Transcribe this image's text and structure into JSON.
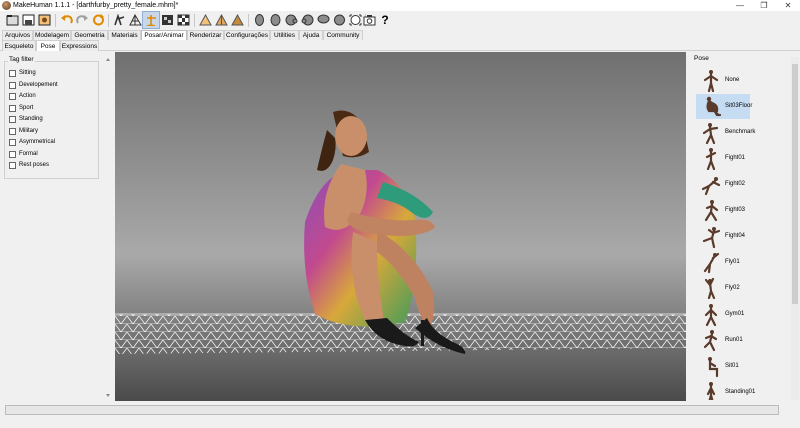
{
  "window": {
    "title": "MakeHuman 1.1.1 - [darthfurby_pretty_female.mhm]*",
    "minimize_glyph": "—",
    "maximize_glyph": "❐",
    "close_glyph": "✕"
  },
  "toolbar": {
    "buttons": [
      {
        "icon": "undo-icon"
      },
      {
        "icon": "redo-icon"
      },
      {
        "icon": "reset-icon"
      },
      {
        "icon": "skeleton-toggle-icon"
      },
      {
        "icon": "wireframe-toggle-icon"
      },
      {
        "icon": "pose-toggle-icon"
      },
      {
        "icon": "background-toggle-icon"
      },
      {
        "icon": "checker-toggle-icon"
      },
      {
        "icon": "front-view-icon"
      },
      {
        "icon": "side-view-icon"
      },
      {
        "icon": "back-view-icon"
      },
      {
        "icon": "head-view-1-icon"
      },
      {
        "icon": "head-view-2-icon"
      },
      {
        "icon": "head-view-3-icon"
      },
      {
        "icon": "head-view-4-icon"
      },
      {
        "icon": "head-view-5-icon"
      },
      {
        "icon": "reset-camera-icon"
      },
      {
        "icon": "screenshot-icon"
      }
    ],
    "help_label": "?"
  },
  "tabs": [
    {
      "label": "Arquivos"
    },
    {
      "label": "Modelagem"
    },
    {
      "label": "Geometria"
    },
    {
      "label": "Materiais"
    },
    {
      "label": "Posar/Animar"
    },
    {
      "label": "Renderizar"
    },
    {
      "label": "Configurações"
    },
    {
      "label": "Utilities"
    },
    {
      "label": "Ajuda"
    },
    {
      "label": "Community"
    }
  ],
  "active_tab": "Posar/Animar",
  "subtabs": [
    {
      "label": "Esqueleto"
    },
    {
      "label": "Pose"
    },
    {
      "label": "Expressions"
    }
  ],
  "active_subtab": "Pose",
  "tag_filter": {
    "title": "Tag filter",
    "items": [
      {
        "label": "Sitting",
        "checked": false
      },
      {
        "label": "Developement",
        "checked": false
      },
      {
        "label": "Action",
        "checked": false
      },
      {
        "label": "Sport",
        "checked": false
      },
      {
        "label": "Standing",
        "checked": false
      },
      {
        "label": "Military",
        "checked": false
      },
      {
        "label": "Asymmetrical",
        "checked": false
      },
      {
        "label": "Formal",
        "checked": false
      },
      {
        "label": "Rest poses",
        "checked": false
      }
    ]
  },
  "pose_panel": {
    "title": "Pose",
    "items": [
      {
        "label": "None"
      },
      {
        "label": "Sit03Floor"
      },
      {
        "label": "Benchmark"
      },
      {
        "label": "Fight01"
      },
      {
        "label": "Fight02"
      },
      {
        "label": "Fight03"
      },
      {
        "label": "Fight04"
      },
      {
        "label": "Fly01"
      },
      {
        "label": "Fly02"
      },
      {
        "label": "Gym01"
      },
      {
        "label": "Run01"
      },
      {
        "label": "Sit01"
      },
      {
        "label": "Standing01"
      }
    ],
    "selected": "Sit03Floor"
  },
  "status": {
    "progress": 0.0
  },
  "colors": {
    "accent": "#c6dcf2",
    "viewport_top": "#707070",
    "viewport_bottom": "#4a4a4a",
    "floor_grid": "#f4f4f4",
    "progress": "#06b025"
  }
}
